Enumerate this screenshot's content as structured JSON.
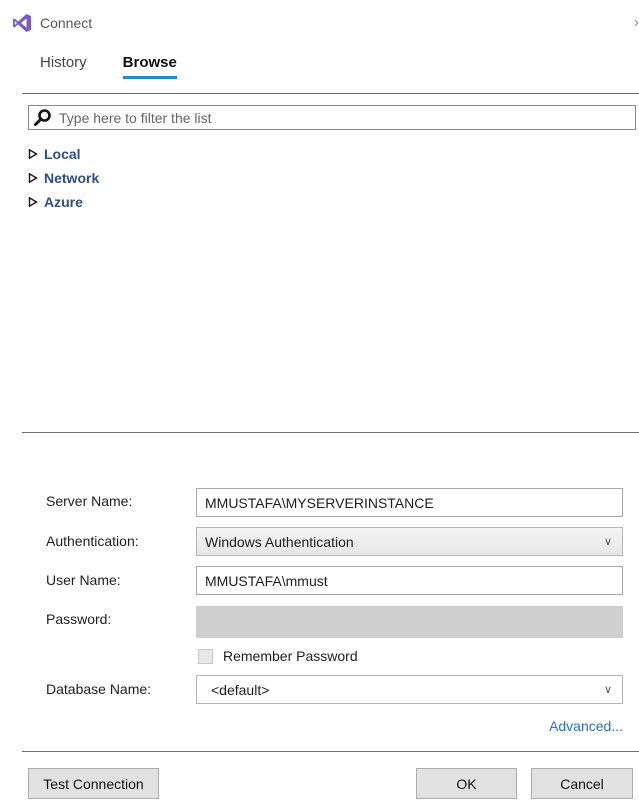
{
  "window": {
    "title": "Connect"
  },
  "tabs": [
    {
      "label": "History",
      "active": false
    },
    {
      "label": "Browse",
      "active": true
    }
  ],
  "search": {
    "placeholder": "Type here to filter the list",
    "value": ""
  },
  "tree": [
    {
      "label": "Local"
    },
    {
      "label": "Network"
    },
    {
      "label": "Azure"
    }
  ],
  "form": {
    "server_name": {
      "label": "Server Name:",
      "value": "MMUSTAFA\\MYSERVERINSTANCE"
    },
    "authentication": {
      "label": "Authentication:",
      "value": "Windows Authentication"
    },
    "user_name": {
      "label": "User Name:",
      "value": "MMUSTAFA\\mmust"
    },
    "password": {
      "label": "Password:",
      "value": ""
    },
    "remember_password": {
      "label": "Remember Password",
      "checked": false
    },
    "database_name": {
      "label": "Database Name:",
      "value": "<default>"
    },
    "advanced_label": "Advanced..."
  },
  "buttons": {
    "test_connection": "Test Connection",
    "ok": "OK",
    "cancel": "Cancel"
  },
  "colors": {
    "accent": "#1e8ad6",
    "tree_text": "#2f4f7f",
    "link": "#2a6fc9"
  }
}
